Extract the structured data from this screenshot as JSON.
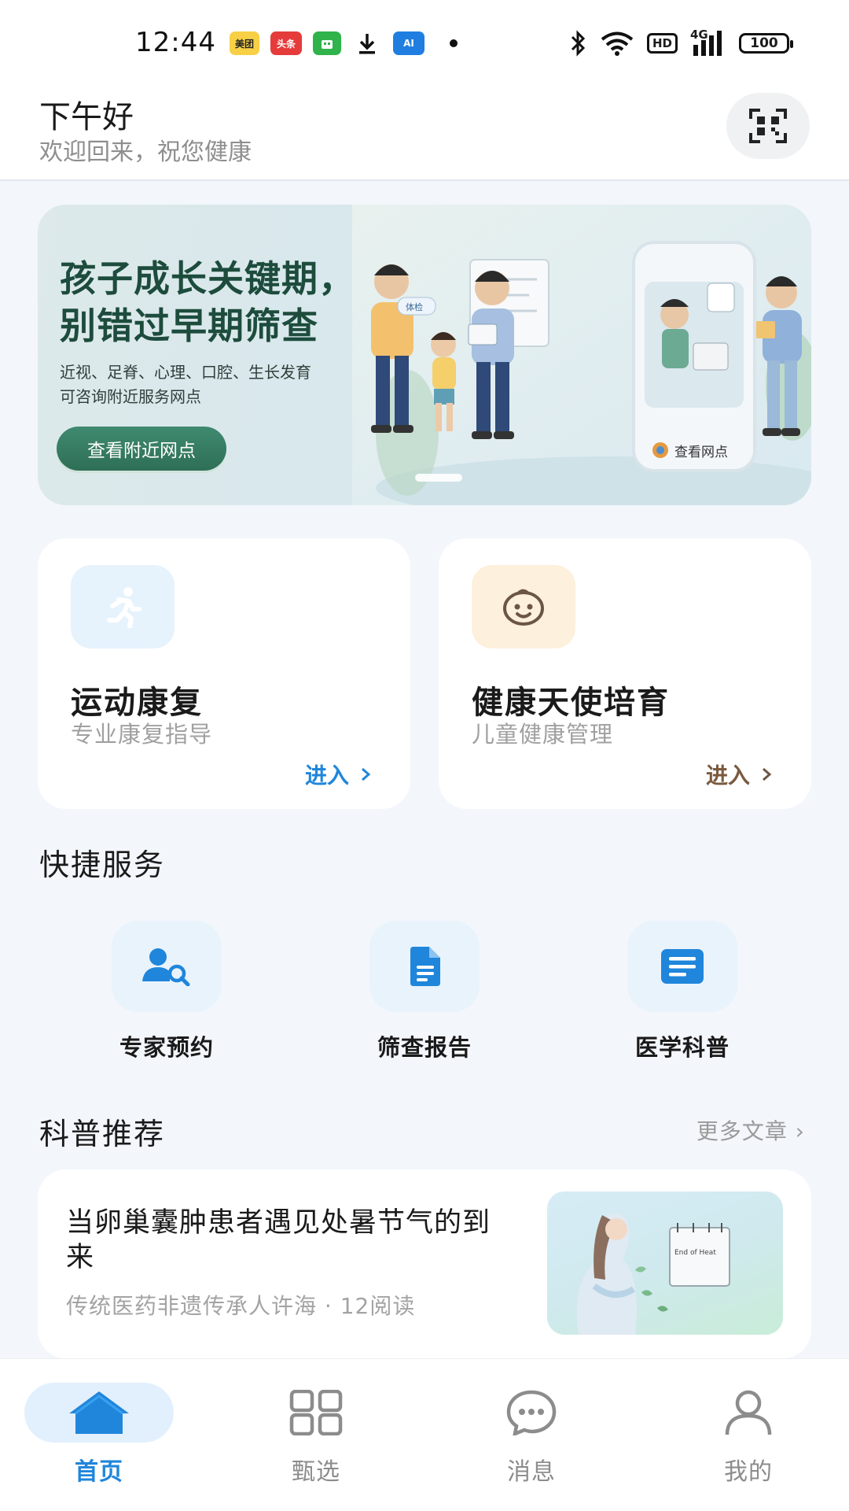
{
  "status_bar": {
    "time": "12:44",
    "app_icons": [
      {
        "name": "meituan-icon",
        "label": "美团",
        "color": "#f7d046"
      },
      {
        "name": "toutiao-icon",
        "label": "头条",
        "color": "#e63b3b"
      },
      {
        "name": "store-icon",
        "label": "",
        "color": "#2fb34a"
      },
      {
        "name": "download-icon",
        "label": "",
        "color": "#111111"
      },
      {
        "name": "ai-app-icon",
        "label": "AI",
        "color": "#1f7ee0"
      }
    ],
    "hd": "HD",
    "network": "4G",
    "battery": "100"
  },
  "header": {
    "greeting": "下午好",
    "subtitle": "欢迎回来，祝您健康"
  },
  "banner": {
    "title": "孩子成长关键期，\n别错过早期筛查",
    "subtitle": "近视、足脊、心理、口腔、生长发育\n可咨询附近服务网点",
    "button": "查看附近网点",
    "phone_label": "查看网点",
    "bubble_text": "体检"
  },
  "feature_cards": [
    {
      "title": "运动康复",
      "subtitle": "专业康复指导",
      "action": "进入",
      "accent": "#1f86db",
      "icon_bg": "#e6f2fc"
    },
    {
      "title": "健康天使培育",
      "subtitle": "儿童健康管理",
      "action": "进入",
      "accent": "#7a5a3e",
      "icon_bg": "#fdf0dc"
    }
  ],
  "quick_services": {
    "title": "快捷服务",
    "items": [
      {
        "label": "专家预约",
        "icon": "expert-search-icon"
      },
      {
        "label": "筛查报告",
        "icon": "report-icon"
      },
      {
        "label": "医学科普",
        "icon": "article-icon"
      }
    ]
  },
  "recommend": {
    "title": "科普推荐",
    "more": "更多文章 ›",
    "article": {
      "title": "当卵巢囊肿患者遇见处暑节气的到来",
      "meta": "传统医药非遗传承人许海 · 12阅读",
      "thumb_text": "End of Heat"
    }
  },
  "tabbar": {
    "tabs": [
      {
        "label": "首页",
        "active": true
      },
      {
        "label": "甄选",
        "active": false
      },
      {
        "label": "消息",
        "active": false
      },
      {
        "label": "我的",
        "active": false
      }
    ]
  },
  "colors": {
    "primary": "#1f86db",
    "banner_green": "#2e6f57",
    "background": "#f3f6fb"
  }
}
